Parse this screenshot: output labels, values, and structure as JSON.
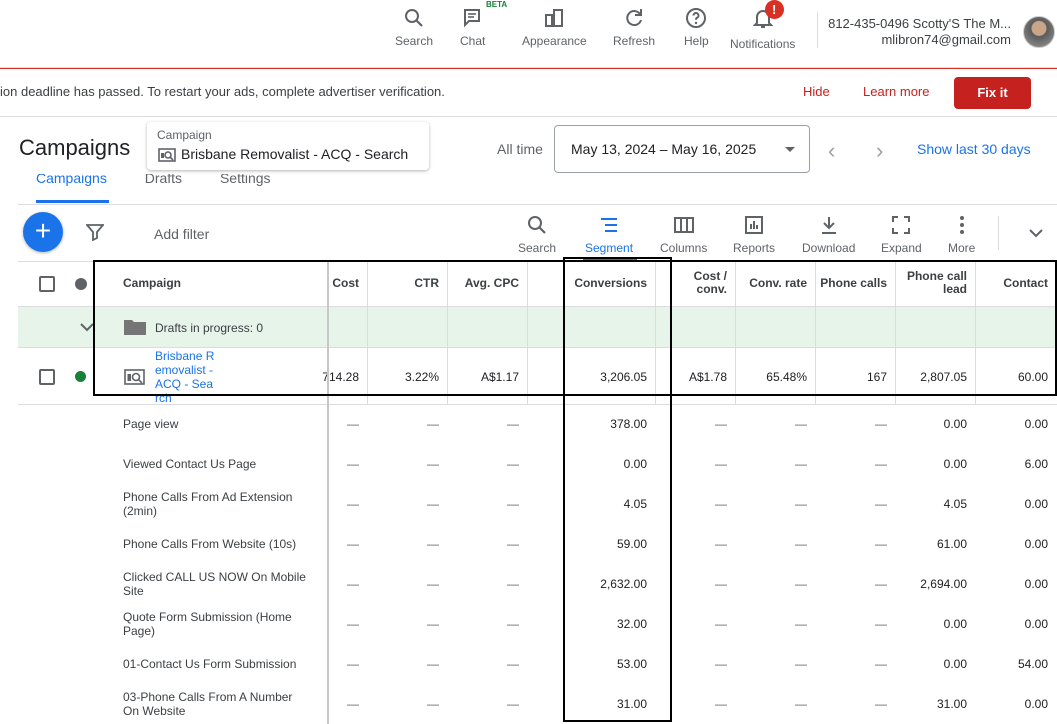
{
  "topbar": {
    "items": [
      {
        "label": "Search",
        "icon": "search-icon"
      },
      {
        "label": "Chat",
        "icon": "chat-icon",
        "badge": "BETA"
      },
      {
        "label": "Appearance",
        "icon": "appearance-icon"
      },
      {
        "label": "Refresh",
        "icon": "refresh-icon"
      },
      {
        "label": "Help",
        "icon": "help-icon"
      },
      {
        "label": "Notifications",
        "icon": "bell-icon",
        "badge": "!"
      }
    ],
    "account_name": "812-435-0496 Scotty'S The M...",
    "account_email": "mlibron74@gmail.com"
  },
  "banner": {
    "text": "ion deadline has passed. To restart your ads, complete advertiser verification.",
    "hide": "Hide",
    "learn_more": "Learn more",
    "fix_it": "Fix it"
  },
  "header": {
    "title": "Campaigns",
    "campaign_label": "Campaign",
    "campaign_value": "Brisbane Removalist - ACQ - Search",
    "all_time": "All time",
    "date_range": "May 13, 2024 – May 16, 2025",
    "show_last": "Show last 30 days",
    "tabs": [
      "Campaigns",
      "Drafts",
      "Settings"
    ]
  },
  "toolbar": {
    "add_filter": "Add filter",
    "tools": [
      {
        "label": "Search",
        "icon": "search-icon"
      },
      {
        "label": "Segment",
        "icon": "segment-icon",
        "active": true
      },
      {
        "label": "Columns",
        "icon": "columns-icon"
      },
      {
        "label": "Reports",
        "icon": "reports-icon"
      },
      {
        "label": "Download",
        "icon": "download-icon"
      },
      {
        "label": "Expand",
        "icon": "expand-icon"
      },
      {
        "label": "More",
        "icon": "more-icon"
      }
    ]
  },
  "table": {
    "headers": {
      "campaign": "Campaign",
      "cost": "Cost",
      "ctr": "CTR",
      "avg_cpc": "Avg. CPC",
      "conversions": "Conversions",
      "cost_conv": "Cost / conv.",
      "conv_rate": "Conv. rate",
      "phone_calls": "Phone calls",
      "phone_call_lead": "Phone call lead",
      "contact": "Contact"
    },
    "drafts": "Drafts in progress: 0",
    "campaign_row": {
      "name": "Brisbane Removalist - ACQ - Search",
      "cost": "714.28",
      "ctr": "3.22%",
      "avg_cpc": "A$1.17",
      "conversions": "3,206.05",
      "cost_conv": "A$1.78",
      "conv_rate": "65.48%",
      "phone_calls": "167",
      "phone_call_lead": "2,807.05",
      "contact": "60.00"
    },
    "dash": "—",
    "segment_rows": [
      {
        "name": "Page view",
        "conversions": "378.00",
        "phone_call_lead": "0.00",
        "contact": "0.00"
      },
      {
        "name": "Viewed Contact Us Page",
        "conversions": "0.00",
        "phone_call_lead": "0.00",
        "contact": "6.00"
      },
      {
        "name": "Phone Calls From Ad Extension (2min)",
        "conversions": "4.05",
        "phone_call_lead": "4.05",
        "contact": "0.00"
      },
      {
        "name": "Phone Calls From Website (10s)",
        "conversions": "59.00",
        "phone_call_lead": "61.00",
        "contact": "0.00"
      },
      {
        "name": "Clicked CALL US NOW On Mobile Site",
        "conversions": "2,632.00",
        "phone_call_lead": "2,694.00",
        "contact": "0.00"
      },
      {
        "name": "Quote Form Submission (Home Page)",
        "conversions": "32.00",
        "phone_call_lead": "0.00",
        "contact": "0.00"
      },
      {
        "name": "01-Contact Us Form Submission",
        "conversions": "53.00",
        "phone_call_lead": "0.00",
        "contact": "54.00"
      },
      {
        "name": "03-Phone Calls From A Number On Website",
        "conversions": "31.00",
        "phone_call_lead": "31.00",
        "contact": "0.00"
      }
    ]
  },
  "colors": {
    "accent": "#1a73e8",
    "error": "#c5221f",
    "draft_bg": "#e6f4ea",
    "status_green": "#188038"
  }
}
